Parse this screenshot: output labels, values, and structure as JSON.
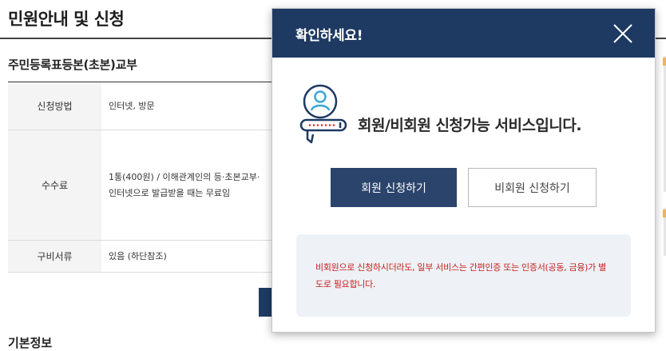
{
  "page": {
    "title": "민원안내 및 신청",
    "section_title": "주민등록표등본(초본)교부",
    "basic_info": "기본정보"
  },
  "info_table": {
    "method": {
      "label": "신청방법",
      "value": "인터넷, 방문"
    },
    "fee": {
      "label": "수수료",
      "line1": "1통(400원) / 이해관계인의 등·초본교부·",
      "line2": "인터넷으로 발급받을 때는 무료임"
    },
    "docs": {
      "label": "구비서류",
      "value": "있음 (하단참조)"
    }
  },
  "modal": {
    "title": "확인하세요!",
    "message": "회원/비회원 신청가능 서비스입니다.",
    "member_button": "회원 신청하기",
    "guest_button": "비회원 신청하기",
    "notice": "비회원으로 신청하시더라도, 일부 서비스는 간편인증 또는 인증서(공동, 금융)가 별도로 필요합니다.",
    "icons": {
      "close": "close-icon",
      "user": "user-card-icon"
    }
  },
  "colors": {
    "header": "#1e3a62",
    "primary_button": "#2a446c",
    "notice_text": "#c8201e",
    "notice_bg": "#eef2f7"
  }
}
